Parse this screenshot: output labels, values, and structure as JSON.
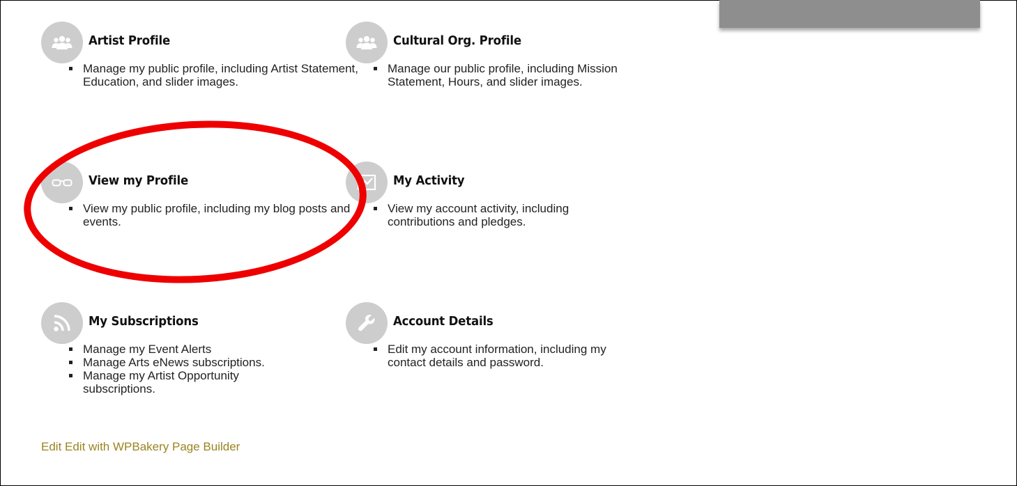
{
  "cards": {
    "artist_profile": {
      "icon": "group-icon",
      "title": "Artist Profile",
      "items": [
        "Manage my public profile, including Artist Statement, Education, and slider images."
      ]
    },
    "cultural_org_profile": {
      "icon": "group-icon",
      "title": "Cultural Org. Profile",
      "items": [
        "Manage our public profile, including Mission Statement, Hours, and slider images."
      ]
    },
    "view_profile": {
      "icon": "glasses-icon",
      "title": "View my Profile",
      "items": [
        "View my public profile, including my blog posts and events."
      ]
    },
    "my_activity": {
      "icon": "activity-chart-icon",
      "title": "My Activity",
      "items": [
        "View my account activity, including contributions and pledges."
      ]
    },
    "my_subscriptions": {
      "icon": "rss-icon",
      "title": "My Subscriptions",
      "items": [
        "Manage my Event Alerts",
        "Manage Arts eNews subscriptions.",
        "Manage my Artist Opportunity subscriptions."
      ]
    },
    "account_details": {
      "icon": "wrench-icon",
      "title": "Account Details",
      "items": [
        "Edit my account information, including my contact details and password."
      ]
    }
  },
  "footer": {
    "edit_link": "Edit Edit with WPBakery Page Builder"
  },
  "colors": {
    "icon_circle": "#cdcdcd",
    "link": "#9b8420",
    "highlight_oval": "#ee0000",
    "top_bar": "#8e8e8e"
  }
}
